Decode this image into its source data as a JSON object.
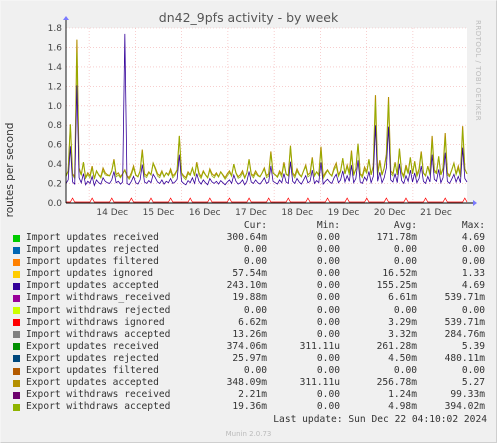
{
  "title": "dn42_9pfs activity - by week",
  "side_label": "RRDTOOL / TOBI OETIKER",
  "footer": "Munin 2.0.73",
  "last_update": "Last update: Sun Dec 22 04:10:02 2024",
  "legend": {
    "headers": [
      "Cur:",
      "Min:",
      "Avg:",
      "Max:"
    ],
    "rows": [
      {
        "label": "Import updates received",
        "color": "#00cc00",
        "cur": "300.64m",
        "min": "0.00",
        "avg": "171.78m",
        "max": "4.69"
      },
      {
        "label": "Import updates rejected",
        "color": "#0066b3",
        "cur": "0.00",
        "min": "0.00",
        "avg": "0.00",
        "max": "0.00"
      },
      {
        "label": "Import updates filtered",
        "color": "#ff8000",
        "cur": "0.00",
        "min": "0.00",
        "avg": "0.00",
        "max": "0.00"
      },
      {
        "label": "Import updates ignored",
        "color": "#ffcc00",
        "cur": "57.54m",
        "min": "0.00",
        "avg": "16.52m",
        "max": "1.33"
      },
      {
        "label": "Import updates accepted",
        "color": "#330099",
        "cur": "243.10m",
        "min": "0.00",
        "avg": "155.25m",
        "max": "4.69"
      },
      {
        "label": "Import withdraws_received",
        "color": "#990099",
        "cur": "19.88m",
        "min": "0.00",
        "avg": "6.61m",
        "max": "539.71m"
      },
      {
        "label": "Import withdraws rejected",
        "color": "#ccff00",
        "cur": "0.00",
        "min": "0.00",
        "avg": "0.00",
        "max": "0.00"
      },
      {
        "label": "Import withdraws ignored",
        "color": "#ff0000",
        "cur": "6.62m",
        "min": "0.00",
        "avg": "3.29m",
        "max": "539.71m"
      },
      {
        "label": "Import withdraws accepted",
        "color": "#808080",
        "cur": "13.26m",
        "min": "0.00",
        "avg": "3.32m",
        "max": "284.76m"
      },
      {
        "label": "Export updates received",
        "color": "#008f00",
        "cur": "374.06m",
        "min": "311.11u",
        "avg": "261.28m",
        "max": "5.39"
      },
      {
        "label": "Export updates rejected",
        "color": "#00487d",
        "cur": "25.97m",
        "min": "0.00",
        "avg": "4.50m",
        "max": "480.11m"
      },
      {
        "label": "Export updates filtered",
        "color": "#b35a00",
        "cur": "0.00",
        "min": "0.00",
        "avg": "0.00",
        "max": "0.00"
      },
      {
        "label": "Export updates accepted",
        "color": "#b38f00",
        "cur": "348.09m",
        "min": "311.11u",
        "avg": "256.78m",
        "max": "5.27"
      },
      {
        "label": "Export withdraws received",
        "color": "#6b006b",
        "cur": "2.21m",
        "min": "0.00",
        "avg": "1.24m",
        "max": "99.33m"
      },
      {
        "label": "Export withdraws accepted",
        "color": "#8fb300",
        "cur": "19.36m",
        "min": "0.00",
        "avg": "4.98m",
        "max": "394.02m"
      }
    ]
  },
  "chart_data": {
    "type": "line",
    "title": "dn42_9pfs activity - by week",
    "ylabel": "routes per second",
    "xlabel": "",
    "ylim": [
      0,
      1.8
    ],
    "yticks": [
      0.0,
      0.2,
      0.4,
      0.6,
      0.8,
      1.0,
      1.2,
      1.4,
      1.6,
      1.8
    ],
    "x_ticks": [
      "14 Dec",
      "15 Dec",
      "16 Dec",
      "17 Dec",
      "18 Dec",
      "19 Dec",
      "20 Dec",
      "21 Dec"
    ],
    "grid": true,
    "x_start": "13 Dec 12:00",
    "x_end": "22 Dec 04:00",
    "series": [
      {
        "name": "Export updates accepted",
        "color": "#b38f00",
        "values": [
          0.28,
          0.33,
          0.81,
          0.3,
          0.27,
          1.68,
          0.36,
          0.29,
          0.42,
          0.26,
          0.31,
          0.28,
          0.38,
          0.25,
          0.33,
          0.29,
          0.27,
          0.36,
          0.31,
          0.29,
          0.28,
          0.33,
          0.45,
          0.29,
          0.31,
          0.27,
          0.3,
          0.34,
          0.28,
          0.26,
          0.31,
          0.38,
          0.29,
          0.27,
          0.33,
          0.55,
          0.3,
          0.28,
          0.32,
          0.29,
          0.41,
          0.36,
          0.3,
          0.28,
          0.33,
          0.27,
          0.31,
          0.29,
          0.35,
          0.28,
          0.3,
          0.34,
          0.69,
          0.31,
          0.28,
          0.26,
          0.32,
          0.29,
          0.36,
          0.28,
          0.42,
          0.31,
          0.27,
          0.33,
          0.29,
          0.26,
          0.35,
          0.3,
          0.28,
          0.31,
          0.27,
          0.32,
          0.29,
          0.26,
          0.3,
          0.33,
          0.28,
          0.4,
          0.31,
          0.27,
          0.29,
          0.33,
          0.26,
          0.31,
          0.45,
          0.3,
          0.28,
          0.33,
          0.29,
          0.27,
          0.31,
          0.36,
          0.28,
          0.3,
          0.53,
          0.31,
          0.29,
          0.27,
          0.33,
          0.29,
          0.42,
          0.3,
          0.28,
          0.59,
          0.31,
          0.28,
          0.35,
          0.3,
          0.27,
          0.33,
          0.39,
          0.29,
          0.31,
          0.47,
          0.28,
          0.32,
          0.29,
          0.58,
          0.27,
          0.31,
          0.34,
          0.3,
          0.28,
          0.36,
          0.41,
          0.29,
          0.33,
          0.46,
          0.3,
          0.39,
          0.31,
          0.54,
          0.29,
          0.35,
          0.61,
          0.3,
          0.28,
          0.37,
          0.32,
          0.45,
          0.29,
          0.38,
          1.11,
          0.31,
          0.44,
          0.29,
          0.36,
          0.5,
          1.09,
          0.33,
          0.3,
          0.42,
          0.29,
          0.56,
          0.32,
          0.28,
          0.39,
          0.31,
          0.47,
          0.3,
          0.43,
          0.29,
          0.35,
          0.53,
          0.31,
          0.28,
          0.38,
          0.3,
          0.69,
          0.34,
          0.31,
          0.48,
          0.29,
          0.36,
          0.72,
          0.31,
          0.28,
          0.34,
          0.41,
          0.3,
          0.38,
          0.29,
          0.79,
          0.35,
          0.3
        ]
      }
    ]
  }
}
